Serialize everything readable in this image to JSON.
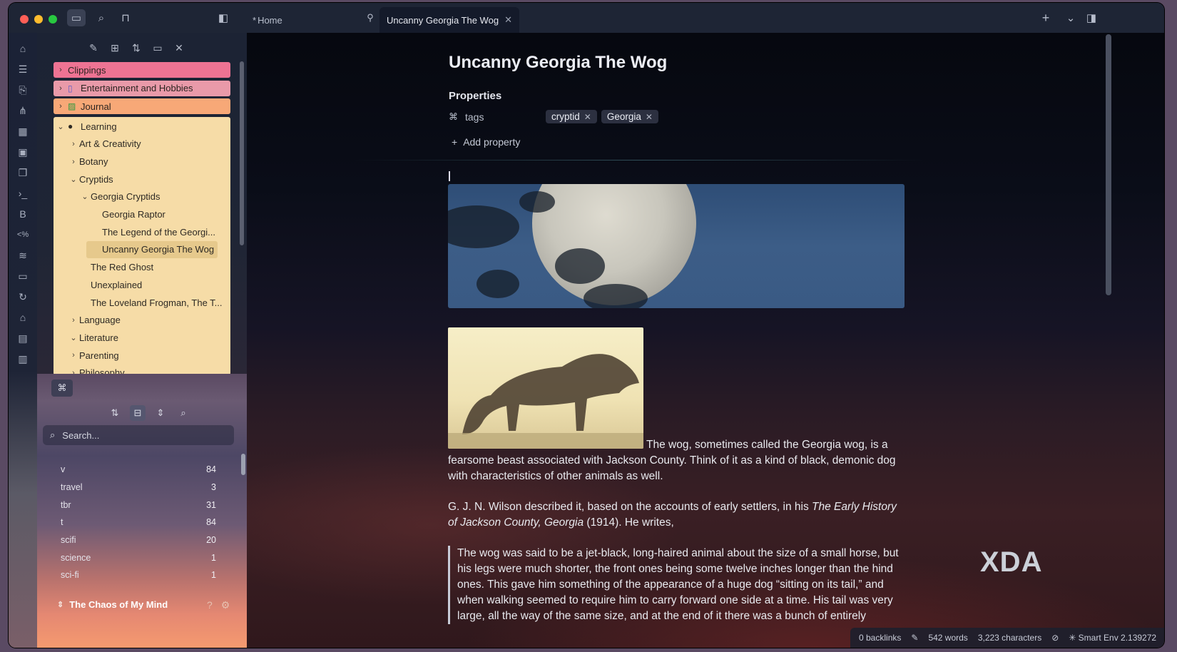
{
  "tabs": [
    {
      "label": "Home",
      "active": false
    },
    {
      "label": "Uncanny Georgia The Wog",
      "active": true
    }
  ],
  "file_tree": {
    "top_folders": [
      {
        "label": "Clippings",
        "icon": ""
      },
      {
        "label": "Entertainment and Hobbies",
        "icon": "book-icon"
      },
      {
        "label": "Journal",
        "icon": "journal-icon"
      }
    ],
    "learning": {
      "label": "Learning",
      "icon": "brain-icon",
      "children": [
        {
          "label": "Art & Creativity",
          "type": "folder",
          "expanded": false,
          "depth": 1
        },
        {
          "label": "Botany",
          "type": "folder",
          "expanded": false,
          "depth": 1
        },
        {
          "label": "Cryptids",
          "type": "folder",
          "expanded": true,
          "depth": 1
        },
        {
          "label": "Georgia Cryptids",
          "type": "folder",
          "expanded": true,
          "depth": 2
        },
        {
          "label": "Georgia Raptor",
          "type": "file",
          "depth": 3
        },
        {
          "label": "The Legend of the Georgi...",
          "type": "file",
          "depth": 3
        },
        {
          "label": "Uncanny Georgia The Wog",
          "type": "file",
          "depth": 3,
          "selected": true
        },
        {
          "label": "The Red Ghost",
          "type": "file",
          "depth": 2
        },
        {
          "label": "Unexplained",
          "type": "file",
          "depth": 2
        },
        {
          "label": "The Loveland Frogman, The T...",
          "type": "file",
          "depth": 2
        },
        {
          "label": "Language",
          "type": "folder",
          "expanded": false,
          "depth": 1
        },
        {
          "label": "Literature",
          "type": "folder",
          "expanded": true,
          "depth": 1
        },
        {
          "label": "Parenting",
          "type": "folder",
          "expanded": false,
          "depth": 1
        },
        {
          "label": "Philosophy",
          "type": "folder",
          "expanded": false,
          "depth": 1
        }
      ]
    }
  },
  "tag_pane": {
    "search_placeholder": "Search...",
    "tags": [
      {
        "name": "v",
        "count": "84"
      },
      {
        "name": "travel",
        "count": "3"
      },
      {
        "name": "tbr",
        "count": "31"
      },
      {
        "name": "t",
        "count": "84"
      },
      {
        "name": "scifi",
        "count": "20"
      },
      {
        "name": "science",
        "count": "1"
      },
      {
        "name": "sci-fi",
        "count": "1"
      }
    ],
    "vault_name": "The Chaos of My Mind"
  },
  "note": {
    "title": "Uncanny Georgia The Wog",
    "properties_heading": "Properties",
    "prop_key": "tags",
    "tags": [
      "cryptid",
      "Georgia"
    ],
    "add_property": "Add property",
    "para1": "The wog, sometimes called the Georgia wog, is a fearsome beast associated with Jackson County. Think of it as a kind of black, demonic dog with characteristics of other animals as well.",
    "para2_start": "G. J. N. Wilson described it, based on the accounts of early settlers, in his ",
    "para2_italic": "The Early History of Jackson County, Georgia",
    "para2_end": " (1914). He writes,",
    "quote": "The wog was said to be a jet-black, long-haired animal about the size of a small horse, but his legs were much shorter, the front ones being some twelve inches longer than the hind ones. This gave him something of the appearance of a huge dog “sitting on its tail,” and when walking seemed to require him to carry forward one side at a time. His tail was very large, all the way of the same size, and at the end of it there was a bunch of entirely"
  },
  "status_bar": {
    "backlinks": "0 backlinks",
    "words": "542 words",
    "characters": "3,223 characters",
    "smart_env": "Smart Env 2.139272"
  },
  "watermark": "XDA"
}
